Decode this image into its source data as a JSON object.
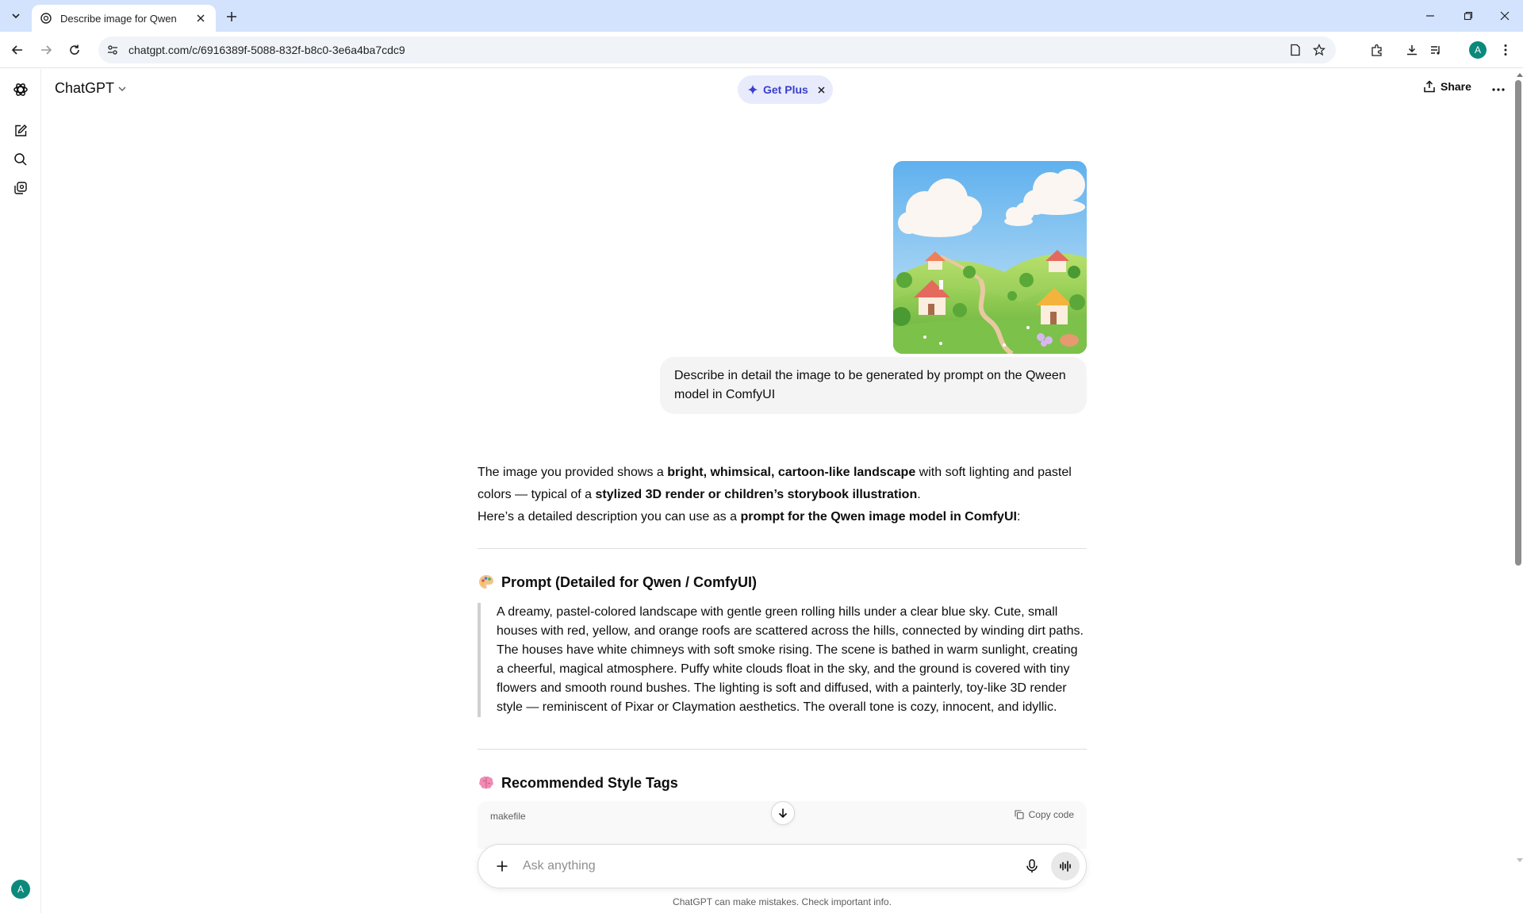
{
  "browser": {
    "tab_title": "Describe image for Qwen",
    "url": "chatgpt.com/c/6916389f-5088-832f-b8c0-3e6a4ba7cdc9",
    "profile_initial": "A"
  },
  "app": {
    "model_name": "ChatGPT",
    "get_plus_label": "Get Plus",
    "share_label": "Share",
    "user_initial": "A"
  },
  "conversation": {
    "user_message": "Describe in detail the image to be generated by prompt on the Qween model in ComfyUI",
    "answer": {
      "p1_a": "The image you provided shows a ",
      "p1_b": "bright, whimsical, cartoon-like landscape",
      "p1_c": " with soft lighting and pastel colors — typical of a ",
      "p1_d": "stylized 3D render or children’s storybook illustration",
      "p1_e": ".",
      "p2_a": "Here’s a detailed description you can use as a ",
      "p2_b": "prompt for the Qwen image model in ComfyUI",
      "p2_c": ":"
    },
    "section1_title": "Prompt (Detailed for Qwen / ComfyUI)",
    "prompt_quote": "A dreamy, pastel-colored landscape with gentle green rolling hills under a clear blue sky. Cute, small houses with red, yellow, and orange roofs are scattered across the hills, connected by winding dirt paths. The houses have white chimneys with soft smoke rising. The scene is bathed in warm sunlight, creating a cheerful, magical atmosphere. Puffy white clouds float in the sky, and the ground is covered with tiny flowers and smooth round bushes. The lighting is soft and diffused, with a painterly, toy-like 3D render style — reminiscent of Pixar or Claymation aesthetics. The overall tone is cozy, innocent, and idyllic.",
    "section2_title": "Recommended Style Tags",
    "code_lang": "makefile",
    "copy_code_label": "Copy code"
  },
  "composer": {
    "placeholder": "Ask anything",
    "disclaimer": "ChatGPT can make mistakes. Check important info."
  },
  "icons": {
    "emoji_section1": "palette-icon",
    "emoji_section2": "brain-icon"
  },
  "colors": {
    "tabstrip": "#d3e3fd",
    "accent_plus": "#3a3fcc",
    "avatar": "#0b8a7c"
  }
}
